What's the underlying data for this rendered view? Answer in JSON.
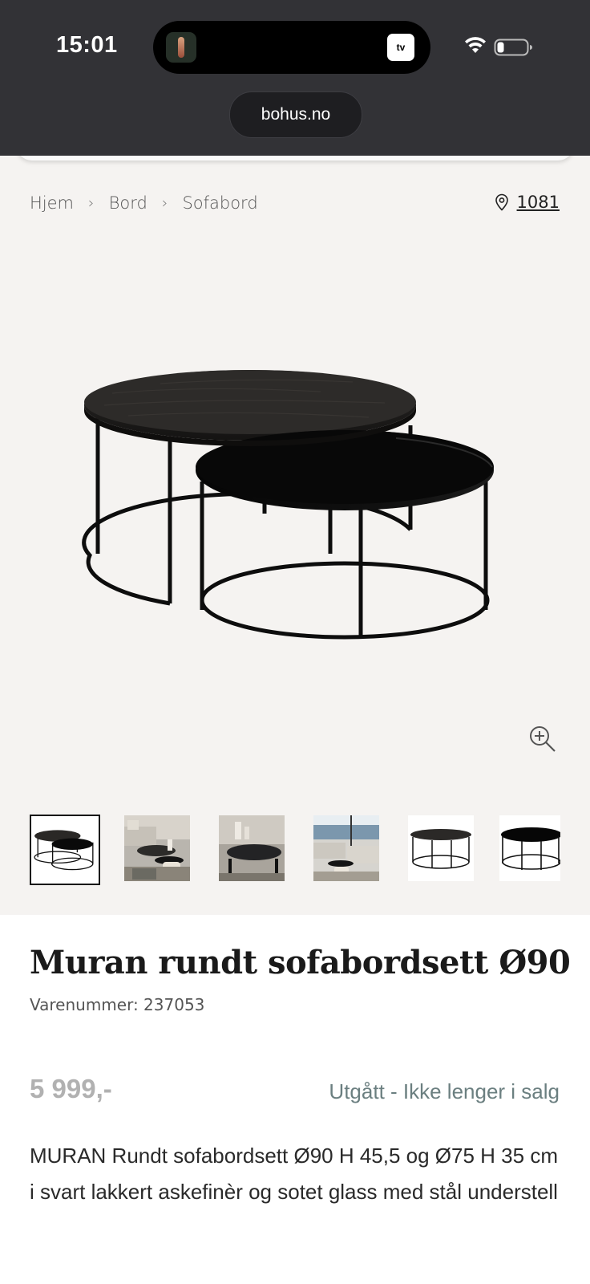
{
  "status_bar": {
    "time": "15:01",
    "tv_label": "tv"
  },
  "browser": {
    "url": "bohus.no"
  },
  "breadcrumb": {
    "items": [
      "Hjem",
      "Bord",
      "Sofabord"
    ],
    "separator": "›"
  },
  "store": {
    "code": "1081",
    "icon": "location-pin-icon"
  },
  "gallery": {
    "zoom_icon": "zoom-in-icon",
    "thumbnail_count": 6,
    "selected_index": 0
  },
  "product": {
    "title": "Muran rundt sofabordsett Ø90",
    "sku": "Varenummer: 237053",
    "price": "5 999,-",
    "availability": "Utgått - Ikke lenger i salg",
    "description": "MURAN Rundt sofabordsett Ø90 H 45,5 og Ø75 H 35 cm i svart lakkert askefinèr og sotet glass med stål understell"
  },
  "colors": {
    "chrome": "#323236",
    "gallery_bg": "#f5f3f1",
    "status_text": "#6b7f80",
    "price_muted": "#b1b1b1"
  }
}
